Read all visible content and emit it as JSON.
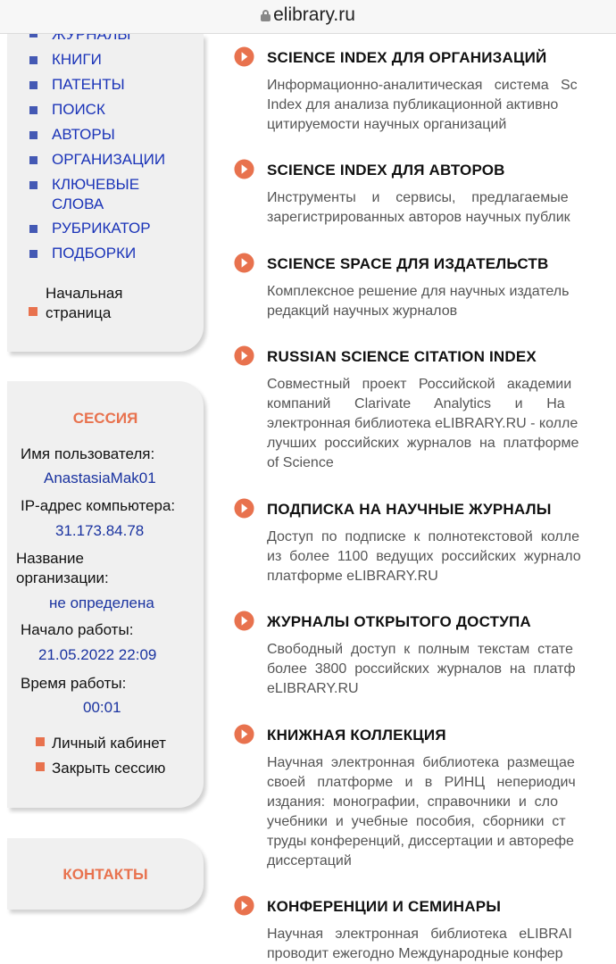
{
  "urlbar": {
    "domain": "elibrary.ru",
    "lock_icon": "lock-icon"
  },
  "menu": {
    "items": [
      {
        "label": "ЖУРНАЛЫ"
      },
      {
        "label": "КНИГИ"
      },
      {
        "label": "ПАТЕНТЫ"
      },
      {
        "label": "ПОИСК"
      },
      {
        "label": "АВТОРЫ"
      },
      {
        "label": "ОРГАНИЗАЦИИ"
      },
      {
        "label": "КЛЮЧЕВЫЕ\nСЛОВА"
      },
      {
        "label": "РУБРИКАТОР"
      },
      {
        "label": "ПОДБОРКИ"
      }
    ],
    "home": "Начальная\nстраница"
  },
  "session": {
    "title": "СЕССИЯ",
    "username_label": "Имя пользователя:",
    "username": "AnastasiaMak01",
    "ip_label": "IP-адрес компьютера:",
    "ip": "31.173.84.78",
    "org_label": "Название\nорганизации:",
    "org": "не определена",
    "start_label": "Начало работы:",
    "start": "21.05.2022 22:09",
    "duration_label": "Время работы:",
    "duration": "00:01",
    "cabinet_link": "Личный кабинет",
    "close_link": "Закрыть сессию"
  },
  "contacts": {
    "title": "КОНТАКТЫ"
  },
  "content": {
    "items": [
      {
        "title": "SCIENCE INDEX ДЛЯ ОРГАНИЗАЦИЙ",
        "desc": "Информационно-аналитическая   система   Sc\nIndex для анализа публикационной активно\nцитируемости научных организаций"
      },
      {
        "title": "SCIENCE INDEX ДЛЯ АВТОРОВ",
        "desc": "Инструменты    и    сервисы,    предлагаемые\nзарегистрированных авторов научных публик"
      },
      {
        "title": "SCIENCE SPACE ДЛЯ ИЗДАТЕЛЬСТВ",
        "desc": "Комплексное решение для научных издатель\nредакций научных журналов"
      },
      {
        "title": "RUSSIAN SCIENCE CITATION INDEX",
        "desc": "Совместный   проект   Российской   академии\nкомпаний      Clarivate      Analytics      и      Ha\nэлектронная библиотека eLIBRARY.RU - колле\nлучших  российских  журналов  на  платформе\nof Science"
      },
      {
        "title": "ПОДПИСКА НА НАУЧНЫЕ ЖУРНАЛЫ",
        "desc": "Доступ  по  подписке  к  полнотекстовой  колле\nиз  более  1100  ведущих  российских  журнало\nплатформе eLIBRARY.RU"
      },
      {
        "title": "ЖУРНАЛЫ ОТКРЫТОГО ДОСТУПА",
        "desc": "Свободный  доступ  к  полным  текстам  стате\nболее  3800  российских  журналов  на  платф\neLIBRARY.RU"
      },
      {
        "title": "КНИЖНАЯ КОЛЛЕКЦИЯ",
        "desc": "Научная  электронная  библиотека  размещае\nсвоей   платформе   и   в   РИНЦ   непериодич\nиздания:  монографии,  справочники  и  сло\nучебники  и  учебные  пособия,  сборники  ст\nтруды конференций, диссертации и авторефе\nдиссертаций"
      },
      {
        "title": "КОНФЕРЕНЦИИ И СЕМИНАРЫ",
        "desc": "Научная   электронная   библиотека   eLIBRAI\nпроводит ежегодно Международные конфер"
      }
    ]
  },
  "colors": {
    "accent": "#e8724e",
    "link_blue": "#1a33b8",
    "panel_bg": "#f0f0f0"
  }
}
